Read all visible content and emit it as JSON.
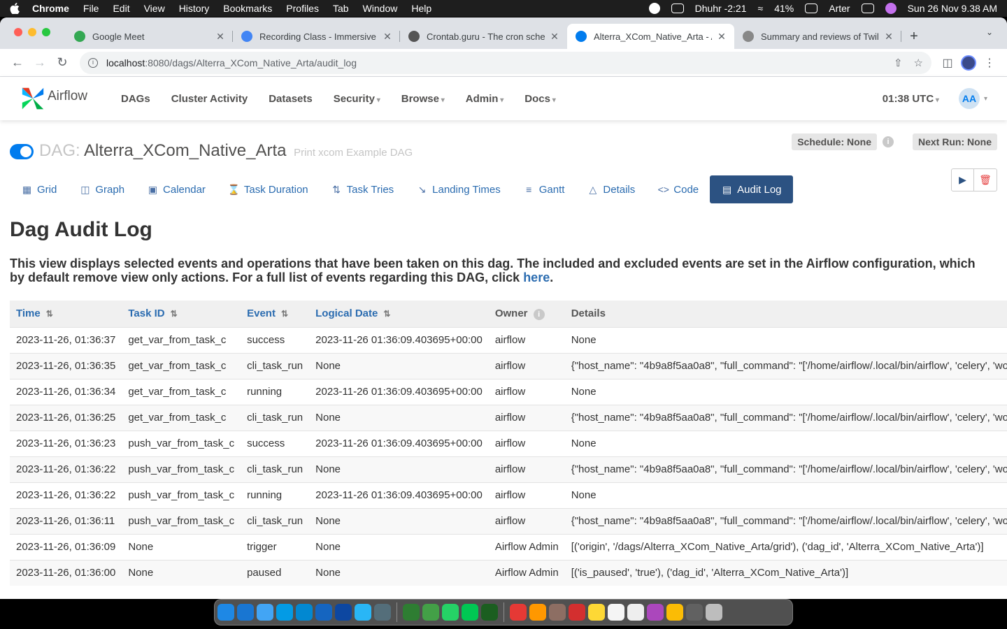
{
  "menubar": {
    "app": "Chrome",
    "items": [
      "File",
      "Edit",
      "View",
      "History",
      "Bookmarks",
      "Profiles",
      "Tab",
      "Window",
      "Help"
    ],
    "prayer": "Dhuhr -2:21",
    "battery": "41%",
    "user": "Arter",
    "datetime": "Sun 26 Nov  9.38 AM"
  },
  "browser": {
    "tabs": [
      {
        "title": "Google Meet",
        "favicon_color": "#34a853"
      },
      {
        "title": "Recording Class - Immersive D",
        "favicon_color": "#4285f4"
      },
      {
        "title": "Crontab.guru - The cron sche",
        "favicon_color": "#555555"
      },
      {
        "title": "Alterra_XCom_Native_Arta - A",
        "favicon_color": "#017cee"
      },
      {
        "title": "Summary and reviews of Twilig",
        "favicon_color": "#888888"
      }
    ],
    "active_tab": 3,
    "url_host": "localhost",
    "url_path": ":8080/dags/Alterra_XCom_Native_Arta/audit_log"
  },
  "airflow": {
    "brand": "Airflow",
    "nav": {
      "dags": "DAGs",
      "cluster": "Cluster Activity",
      "datasets": "Datasets",
      "security": "Security",
      "browse": "Browse",
      "admin": "Admin",
      "docs": "Docs"
    },
    "time": "01:38 UTC",
    "user_initials": "AA"
  },
  "dag": {
    "label": "DAG:",
    "id": "Alterra_XCom_Native_Arta",
    "description": "Print xcom Example DAG",
    "schedule": "Schedule: None",
    "next_run": "Next Run: None"
  },
  "view_tabs": {
    "grid": "Grid",
    "graph": "Graph",
    "calendar": "Calendar",
    "task_duration": "Task Duration",
    "task_tries": "Task Tries",
    "landing_times": "Landing Times",
    "gantt": "Gantt",
    "details": "Details",
    "code": "Code",
    "audit_log": "Audit Log"
  },
  "page": {
    "title": "Dag Audit Log",
    "description": "This view displays selected events and operations that have been taken on this dag. The included and excluded events are set in the Airflow configuration, which by default remove view only actions. For a full list of events regarding this DAG, click ",
    "link_text": "here",
    "description_end": "."
  },
  "table": {
    "headers": {
      "time": "Time",
      "task_id": "Task ID",
      "event": "Event",
      "logical_date": "Logical Date",
      "owner": "Owner",
      "details": "Details"
    },
    "rows": [
      {
        "time": "2023-11-26, 01:36:37",
        "task_id": "get_var_from_task_c",
        "event": "success",
        "logical_date": "2023-11-26 01:36:09.403695+00:00",
        "owner": "airflow",
        "details": "None"
      },
      {
        "time": "2023-11-26, 01:36:35",
        "task_id": "get_var_from_task_c",
        "event": "cli_task_run",
        "logical_date": "None",
        "owner": "airflow",
        "details": "{\"host_name\": \"4b9a8f5aa0a8\", \"full_command\": \"['/home/airflow/.local/bin/airflow', 'celery', 'worker']\"}"
      },
      {
        "time": "2023-11-26, 01:36:34",
        "task_id": "get_var_from_task_c",
        "event": "running",
        "logical_date": "2023-11-26 01:36:09.403695+00:00",
        "owner": "airflow",
        "details": "None"
      },
      {
        "time": "2023-11-26, 01:36:25",
        "task_id": "get_var_from_task_c",
        "event": "cli_task_run",
        "logical_date": "None",
        "owner": "airflow",
        "details": "{\"host_name\": \"4b9a8f5aa0a8\", \"full_command\": \"['/home/airflow/.local/bin/airflow', 'celery', 'worker']\"}"
      },
      {
        "time": "2023-11-26, 01:36:23",
        "task_id": "push_var_from_task_c",
        "event": "success",
        "logical_date": "2023-11-26 01:36:09.403695+00:00",
        "owner": "airflow",
        "details": "None"
      },
      {
        "time": "2023-11-26, 01:36:22",
        "task_id": "push_var_from_task_c",
        "event": "cli_task_run",
        "logical_date": "None",
        "owner": "airflow",
        "details": "{\"host_name\": \"4b9a8f5aa0a8\", \"full_command\": \"['/home/airflow/.local/bin/airflow', 'celery', 'worker']\"}"
      },
      {
        "time": "2023-11-26, 01:36:22",
        "task_id": "push_var_from_task_c",
        "event": "running",
        "logical_date": "2023-11-26 01:36:09.403695+00:00",
        "owner": "airflow",
        "details": "None"
      },
      {
        "time": "2023-11-26, 01:36:11",
        "task_id": "push_var_from_task_c",
        "event": "cli_task_run",
        "logical_date": "None",
        "owner": "airflow",
        "details": "{\"host_name\": \"4b9a8f5aa0a8\", \"full_command\": \"['/home/airflow/.local/bin/airflow', 'celery', 'worker']\"}"
      },
      {
        "time": "2023-11-26, 01:36:09",
        "task_id": "None",
        "event": "trigger",
        "logical_date": "None",
        "owner": "Airflow Admin",
        "details": "[('origin', '/dags/Alterra_XCom_Native_Arta/grid'), ('dag_id', 'Alterra_XCom_Native_Arta')]"
      },
      {
        "time": "2023-11-26, 01:36:00",
        "task_id": "None",
        "event": "paused",
        "logical_date": "None",
        "owner": "Airflow Admin",
        "details": "[('is_paused', 'true'), ('dag_id', 'Alterra_XCom_Native_Arta')]"
      }
    ]
  },
  "dock_apps": [
    "#1e88e5",
    "#1976d2",
    "#42a5f5",
    "#039be5",
    "#0288d1",
    "#1565c0",
    "#0d47a1",
    "#29b6f6",
    "#546e7a",
    "#2e7d32",
    "#43a047",
    "#25d366",
    "#00c853",
    "#1b5e20",
    "#e53935",
    "#ff9800",
    "#8d6e63",
    "#d32f2f",
    "#fdd835",
    "#f5f5f5",
    "#eeeeee",
    "#ab47bc",
    "#fbbc05",
    "#616161",
    "#bdbdbd"
  ]
}
